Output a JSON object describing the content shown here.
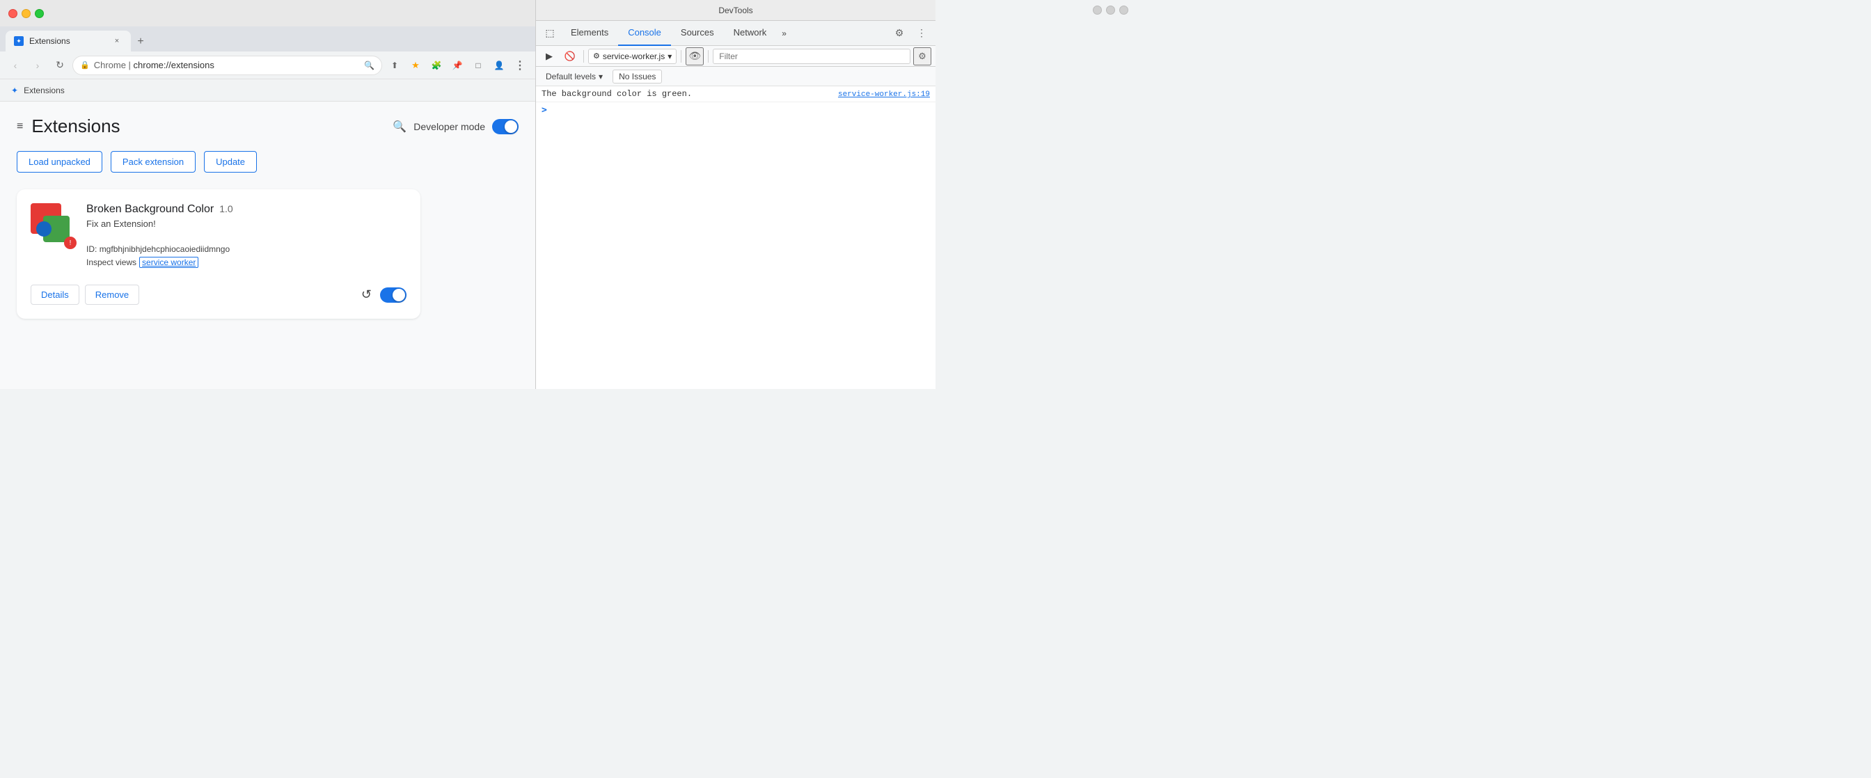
{
  "browser": {
    "traffic_lights": [
      "red",
      "yellow",
      "green"
    ],
    "tab": {
      "favicon_char": "✦",
      "title": "Extensions",
      "close": "×"
    },
    "new_tab": "+",
    "nav": {
      "back": "‹",
      "forward": "›",
      "reload": "↻",
      "address_icon": "🔒",
      "address_protocol": "Chrome  |  ",
      "address_path": "chrome://extensions",
      "zoom": "🔍",
      "share": "⬆",
      "star": "★",
      "puzzle": "🧩",
      "pin": "📌",
      "layout": "□",
      "profile": "👤",
      "menu": "⋮"
    },
    "breadcrumb": {
      "icon": "✦",
      "label": "Extensions"
    },
    "page": {
      "hamburger": "≡",
      "title": "Extensions",
      "search_icon": "🔍",
      "developer_mode_label": "Developer mode",
      "action_buttons": [
        "Load unpacked",
        "Pack extension",
        "Update"
      ],
      "extension": {
        "name": "Broken Background Color",
        "version": "1.0",
        "description": "Fix an Extension!",
        "id_label": "ID:",
        "id_value": "mgfbhjnibhjdehcphiocaoiediidmngo",
        "inspect_label": "Inspect views",
        "inspect_link": "service worker",
        "btn_details": "Details",
        "btn_remove": "Remove"
      }
    }
  },
  "devtools": {
    "title": "DevTools",
    "traffic_lights": [
      "gray1",
      "gray2",
      "gray3"
    ],
    "tabs": [
      {
        "label": "Elements",
        "active": false
      },
      {
        "label": "Console",
        "active": true
      },
      {
        "label": "Sources",
        "active": false
      },
      {
        "label": "Network",
        "active": false
      },
      {
        "label": "»",
        "active": false
      }
    ],
    "toolbar": {
      "play_icon": "▶",
      "stop_icon": "🚫",
      "source_label": "service-worker.js",
      "source_dropdown": "▾",
      "eye_icon": "👁",
      "filter_placeholder": "Filter",
      "settings_icon": "⚙"
    },
    "levels_bar": {
      "default_levels": "Default levels",
      "dropdown_icon": "▾",
      "no_issues": "No Issues"
    },
    "console": {
      "log_message": "The background color is green.",
      "log_source": "service-worker.js:19",
      "prompt": ">"
    }
  }
}
